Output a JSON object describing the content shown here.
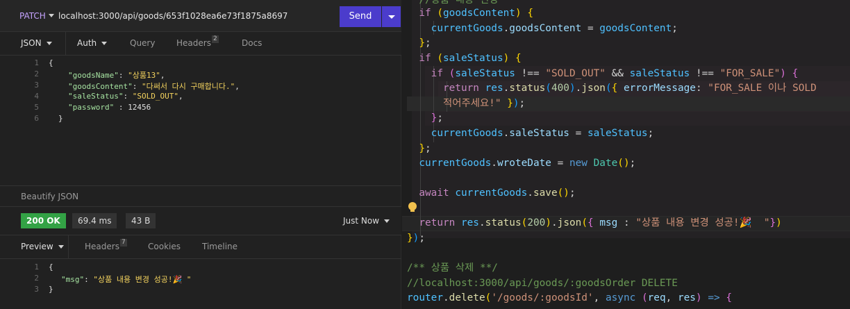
{
  "request": {
    "method": "PATCH",
    "url": "localhost:3000/api/goods/653f1028ea6e73f1875a8697",
    "send_label": "Send",
    "tabs": [
      {
        "label": "JSON"
      },
      {
        "label": "Auth"
      },
      {
        "label": "Query"
      },
      {
        "label": "Headers",
        "badge": "2"
      },
      {
        "label": "Docs"
      }
    ],
    "body_lines": [
      "1",
      "2",
      "3",
      "4",
      "5",
      "6"
    ],
    "body": {
      "l1": "{",
      "k1": "\"goodsName\"",
      "v1": "\"상품13\"",
      "k2": "\"goodsContent\"",
      "v2": "\"다써서 다시 구매합니다.\"",
      "k3": "\"saleStatus\"",
      "v3": "\"SOLD_OUT\"",
      "k4": "\"password\"",
      "v4": "12456",
      "l6": "}"
    },
    "beautify_label": "Beautify JSON"
  },
  "response": {
    "status": "200 OK",
    "time": "69.4 ms",
    "size": "43 B",
    "when": "Just Now",
    "tabs": [
      {
        "label": "Preview"
      },
      {
        "label": "Headers",
        "badge": "7"
      },
      {
        "label": "Cookies"
      },
      {
        "label": "Timeline"
      }
    ],
    "body_lines": [
      "1",
      "2",
      "3"
    ],
    "body": {
      "l1": "{",
      "k1": "\"msg\"",
      "v1": "\"상품 내용 변경 성공!🎉 \"",
      "l3": "}"
    }
  },
  "editor": {
    "t0": "//상품 내용 변경",
    "t_goodsContent": "goodsContent",
    "t_currentGoods": "currentGoods",
    "t_saleStatus": "saleStatus",
    "t_sold_out": "\"SOLD_OUT\"",
    "t_for_sale": "\"FOR_SALE\"",
    "t_400": "400",
    "t_err_a": "\"FOR_SALE 이나 SOLD",
    "t_err_b": "적어주세요!\"",
    "t_wroteDate": "wroteDate",
    "t_Date": "Date",
    "t_save": "save",
    "t_200": "200",
    "t_msg": "\"상품 내용 변경 성공!🎉  \"",
    "t_c1": "/** 상품 삭제 **/",
    "t_c2": "//localhost:3000/api/goods/:goodsOrder DELETE",
    "t_route": "'/goods/:goodsId'"
  },
  "colors": {
    "accent": "#4b3ccc",
    "ok": "#33a245",
    "method": "#c5a3ff"
  }
}
